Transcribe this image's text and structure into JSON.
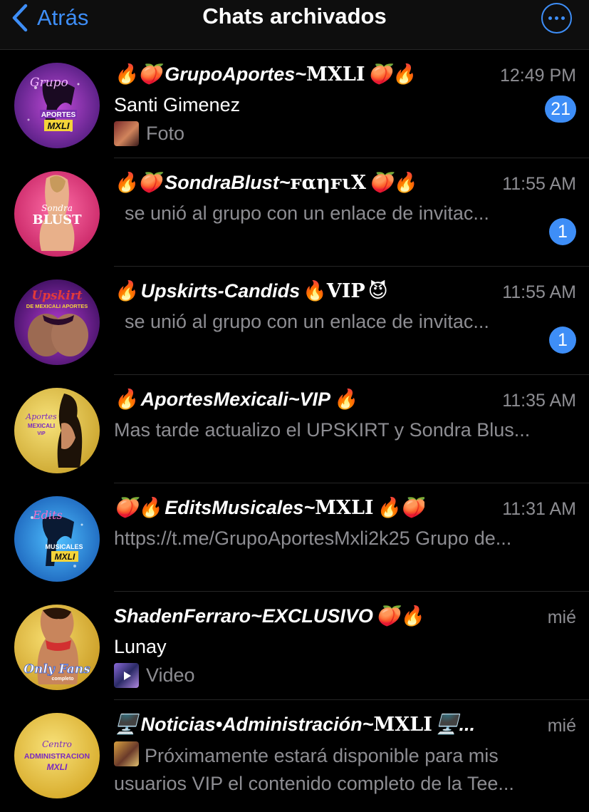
{
  "navbar": {
    "back_label": "Atrás",
    "title": "Chats archivados",
    "accent_color": "#3e8ef7"
  },
  "chats": [
    {
      "name_pre": "🔥🍑",
      "name": "GrupoAportes~",
      "name_deco": "MXLI",
      "name_post": "🍑🔥",
      "time": "12:49 PM",
      "sender": "Santi Gimenez",
      "media_label": "Foto",
      "unread": "21",
      "avatar_text_top": "Grupo",
      "avatar_text_mid": "APORTES",
      "avatar_text_bot": "MXLI"
    },
    {
      "name_pre": "🔥🍑",
      "name": "SondraBlust~",
      "name_deco": "ꜰαηꜰιX",
      "name_post": "🍑🔥",
      "time": "11:55 AM",
      "preview": "se unió al grupo con un enlace de invitac...",
      "unread": "1",
      "avatar_text_top": "Sondra",
      "avatar_text_mid": "BLUST"
    },
    {
      "name_pre": "🔥",
      "name": "Upskirts-Candids",
      "name_deco": "🔥VIP",
      "name_post": "😈",
      "time": "11:55 AM",
      "preview": "se unió al grupo con un enlace de invitac...",
      "unread": "1",
      "avatar_text_top": "Upskirt",
      "avatar_text_mid": "DE MEXICALI APORTES"
    },
    {
      "name_pre": "🔥",
      "name": "AportesMexicali~VIP",
      "name_post": "🔥",
      "time": "11:35 AM",
      "preview": "Mas tarde actualizo el UPSKIRT y Sondra Blus...",
      "avatar_text_top": "Aportes",
      "avatar_text_mid": "MEXICALI",
      "avatar_text_bot": "VIP"
    },
    {
      "name_pre": "🍑🔥",
      "name": "EditsMusicales~",
      "name_deco": "MXLI",
      "name_post": "🔥🍑",
      "time": "11:31 AM",
      "preview": "https://t.me/GrupoAportesMxli2k25 Grupo de...",
      "avatar_text_top": "Edits",
      "avatar_text_mid": "MUSICALES",
      "avatar_text_bot": "MXLI"
    },
    {
      "name": "ShadenFerraro~EXCLUSIVO",
      "name_post": "🍑🔥",
      "time": "mié",
      "sender": "Lunay",
      "media_label": "Video",
      "avatar_text_mid": "Only Fans",
      "avatar_text_bot": "completo"
    },
    {
      "name_pre": "🖥️",
      "name": "Noticias•Administración~",
      "name_deco": "MXLI",
      "name_post": "🖥️...",
      "time": "mié",
      "preview": "Próximamente estará disponible para mis usuarios VIP el contenido completo de la Tee...",
      "avatar_text_top": "Centro",
      "avatar_text_mid": "ADMINISTRACION",
      "avatar_text_bot": "MXLI"
    }
  ]
}
